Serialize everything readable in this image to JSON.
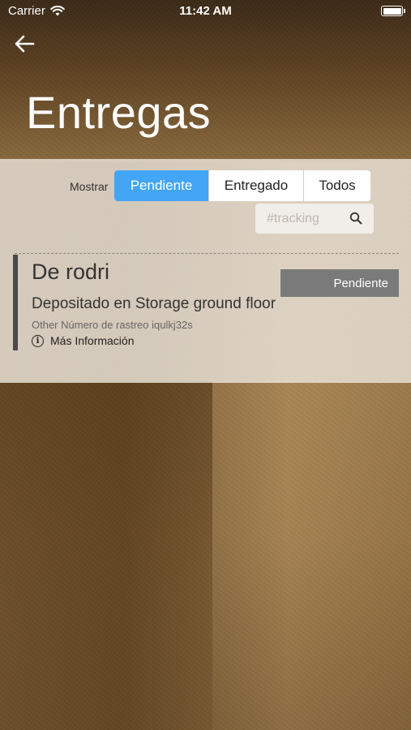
{
  "status_bar": {
    "carrier": "Carrier",
    "time": "11:42 AM",
    "wifi_icon": "wifi-icon",
    "battery_icon": "battery-icon"
  },
  "nav": {
    "back_icon": "arrow-left-icon"
  },
  "page": {
    "title": "Entregas"
  },
  "filter": {
    "label": "Mostrar",
    "options": [
      "Pendiente",
      "Entregado",
      "Todos"
    ],
    "selected": "Pendiente",
    "active_color": "#42a5f5"
  },
  "search": {
    "placeholder": "#tracking",
    "value": "",
    "icon": "search-icon"
  },
  "deliveries": [
    {
      "title": "De rodri",
      "status": "Pendiente",
      "location": "Depositado en Storage ground floor",
      "tracking": "Other Número de rastreo iqulkj32s",
      "more_info": "Más Información",
      "info_icon": "info-icon"
    }
  ]
}
